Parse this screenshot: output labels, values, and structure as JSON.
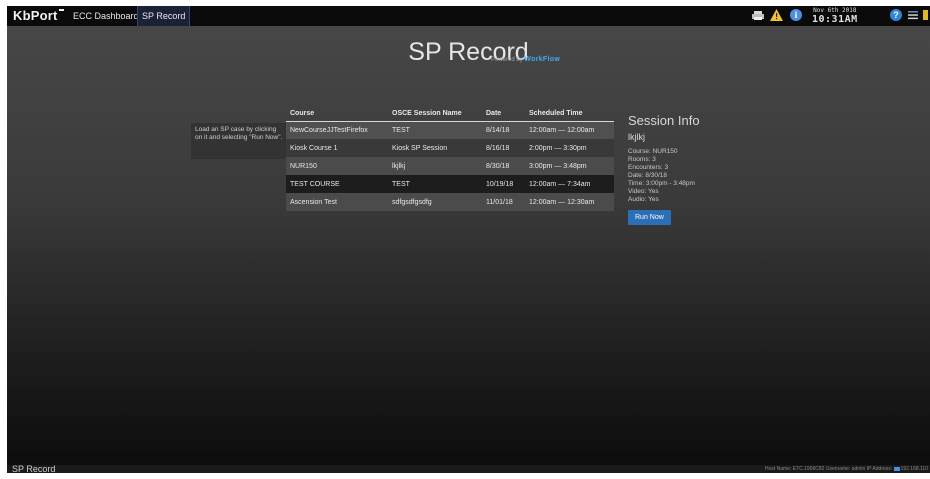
{
  "topbar": {
    "logo": "KbPort",
    "tabs": [
      {
        "label": "ECC Dashboard"
      },
      {
        "label": "SP Record"
      }
    ],
    "clock": {
      "date": "Nov 6th 2018",
      "time": "10:31AM"
    },
    "info_glyph": "i",
    "help_glyph": "?",
    "icons": [
      "printer-icon",
      "warning-icon",
      "info-icon",
      "help-icon",
      "settings-icon"
    ]
  },
  "page": {
    "title": "SP Record",
    "powered_by": "Powered by",
    "powered_brand": "WorkFlow"
  },
  "help_text": "Load an SP case by clicking on it and selecting \"Run Now\".",
  "table": {
    "headers": [
      "Course",
      "OSCE Session Name",
      "Date",
      "Scheduled Time"
    ],
    "rows": [
      [
        "NewCourseJJTestFirefox",
        "TEST",
        "8/14/18",
        "12:00am — 12:00am"
      ],
      [
        "Kiosk Course 1",
        "Kiosk SP Session",
        "8/16/18",
        "2:00pm — 3:30pm"
      ],
      [
        "NUR150",
        "lkjlkj",
        "8/30/18",
        "3:00pm — 3:48pm"
      ],
      [
        "TEST COURSE",
        "TEST",
        "10/19/18",
        "12:00am — 7:34am"
      ],
      [
        "Ascension Test",
        "sdfgsdfgsdfg",
        "11/01/18",
        "12:00am — 12:30am"
      ]
    ]
  },
  "session_info": {
    "heading": "Session Info",
    "name": "lkjlkj",
    "lines": [
      "Course: NUR150",
      "Rooms: 3",
      "Encounters: 3",
      "Date: 8/30/18",
      "Time: 3:00pm - 3:48pm",
      "Video: Yes",
      "Audio: Yes"
    ],
    "run_button": "Run Now"
  },
  "statusbar": {
    "title": "SP Record",
    "host": "Host Name: ETC.1956C82",
    "user": "Username: admin",
    "ip_label": "IP Address:",
    "ip": "192.168.110"
  },
  "colors": {
    "accent": "#2c6fb6",
    "selected_tab": "#1b2238",
    "warning": "#f2c12e"
  }
}
